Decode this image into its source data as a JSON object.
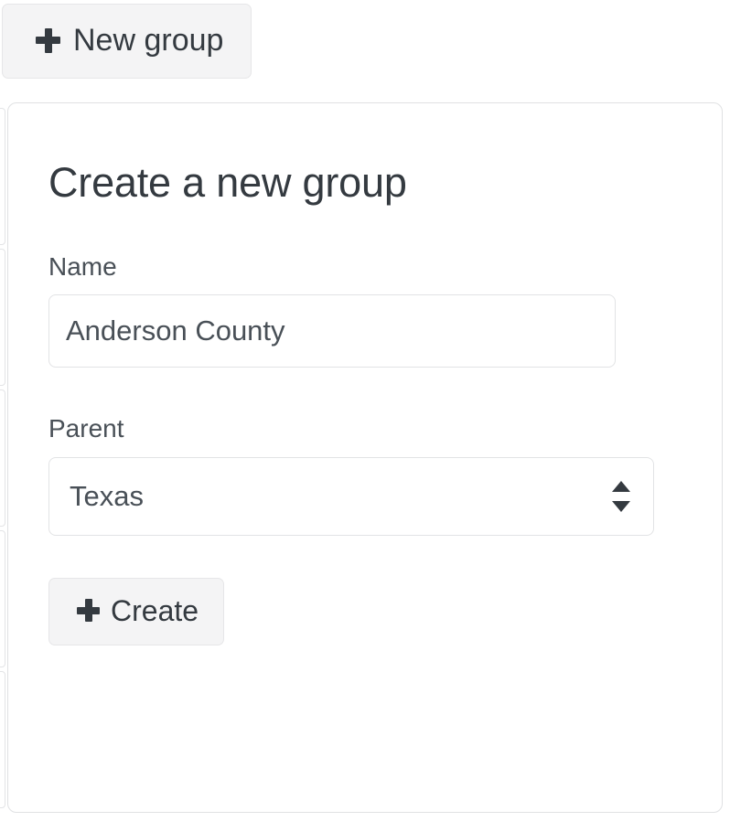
{
  "toolbar": {
    "new_group_label": "New group",
    "new_group_icon": "plus-icon"
  },
  "panel": {
    "title": "Create a new group",
    "name_field": {
      "label": "Name",
      "value": "Anderson County",
      "placeholder": ""
    },
    "parent_field": {
      "label": "Parent",
      "selected": "Texas",
      "options": [
        "Texas"
      ],
      "indicator_icon": "updown-arrows-icon"
    },
    "create_button": {
      "label": "Create",
      "icon": "plus-icon"
    }
  },
  "colors": {
    "button_bg": "#f4f4f5",
    "border": "#e0e1e3",
    "text": "#495057",
    "heading": "#343a40",
    "panel_bg": "#ffffff"
  }
}
